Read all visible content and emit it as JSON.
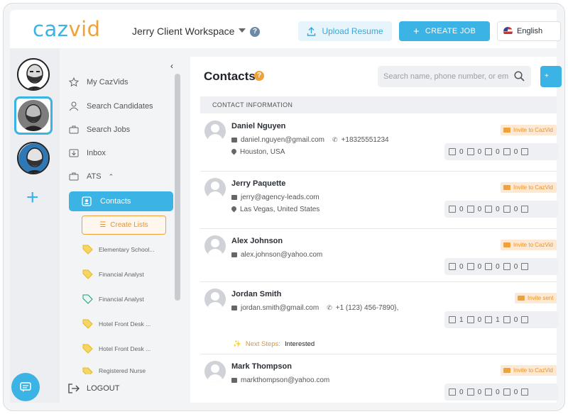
{
  "header": {
    "logo": {
      "part1": "caz",
      "part2": "vid"
    },
    "workspace": "Jerry Client Workspace",
    "upload_label": "Upload Resume",
    "create_job_label": "CREATE JOB",
    "language": "English"
  },
  "sidebar": {
    "items": [
      {
        "label": "My CazVids",
        "icon": "star-icon"
      },
      {
        "label": "Search Candidates",
        "icon": "person-icon"
      },
      {
        "label": "Search Jobs",
        "icon": "briefcase-icon"
      },
      {
        "label": "Inbox",
        "icon": "inbox-icon"
      },
      {
        "label": "ATS",
        "icon": "ats-icon"
      }
    ],
    "active": "Contacts",
    "create_lists": "Create Lists",
    "lists": [
      "Elementary School...",
      "Financial Analyst",
      "Financial Analyst",
      "Hotel Front Desk ...",
      "Hotel Front Desk ...",
      "Registered Nurse"
    ],
    "logout": "LOGOUT"
  },
  "main": {
    "title": "Contacts",
    "search_placeholder": "Search name, phone number, or em",
    "column_header": "CONTACT INFORMATION",
    "contacts": [
      {
        "name": "Daniel Nguyen",
        "email": "daniel.nguyen@gmail.com",
        "phone": "+18325551234",
        "location": "Houston, USA",
        "invite": "Invite to CazVid",
        "counts": [
          "0",
          "0",
          "0",
          "0"
        ]
      },
      {
        "name": "Jerry Paquette",
        "email": "jerry@agency-leads.com",
        "phone": "",
        "location": "Las Vegas, United States",
        "invite": "Invite to CazVid",
        "counts": [
          "0",
          "0",
          "0",
          "0"
        ]
      },
      {
        "name": "Alex Johnson",
        "email": "alex.johnson@yahoo.com",
        "phone": "",
        "location": "",
        "invite": "Invite to CazVid",
        "counts": [
          "0",
          "0",
          "0",
          "0"
        ]
      },
      {
        "name": "Jordan Smith",
        "email": "jordan.smith@gmail.com",
        "phone": "+1 (123) 456-7890},",
        "location": "",
        "invite": "Invite sent",
        "counts": [
          "1",
          "0",
          "1",
          "0"
        ],
        "next_steps_label": "Next Steps:",
        "next_steps_value": "Interested"
      },
      {
        "name": "Mark Thompson",
        "email": "markthompson@yahoo.com",
        "phone": "",
        "location": "",
        "invite": "Invite to CazVid",
        "counts": [
          "0",
          "0",
          "0",
          "0"
        ]
      }
    ]
  },
  "colors": {
    "accent": "#3bb3e4",
    "orange": "#f0a23a"
  }
}
